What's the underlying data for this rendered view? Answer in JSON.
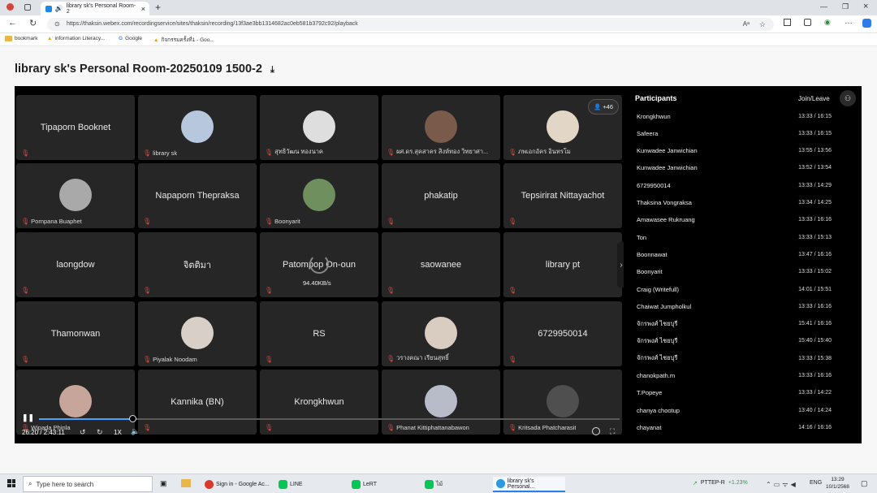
{
  "browser": {
    "tab_title": "library sk's Personal Room-2",
    "url": "https://thaksin.webex.com/recordingservice/sites/thaksin/recording/13f3ae3bb1314682ac0eb581b3792c92/playback",
    "bookmarks": [
      "bookmark",
      "information Literacy...",
      "Google",
      "กิจกรรมครั้งที่1 - Goo..."
    ]
  },
  "recording": {
    "title": "library sk's Personal Room-20250109 1500-2"
  },
  "video": {
    "more_badge": "+46",
    "buffer_speed": "94.40KB/s",
    "tiles": [
      {
        "name": "Tipaporn Booknet",
        "label": "",
        "has_avatar": false
      },
      {
        "name": "",
        "label": "library sk",
        "has_avatar": true,
        "avatar_color": "#b6c7de"
      },
      {
        "name": "",
        "label": "สุทธิวัฒน ทองนาค",
        "has_avatar": true,
        "avatar_color": "#dedede"
      },
      {
        "name": "",
        "label": "ผศ.ดร.สุคสาคร สิงห์ทอง วิทยาศา...",
        "has_avatar": true,
        "avatar_color": "#7a5a4a"
      },
      {
        "name": "",
        "label": "ภพเอกอัคร อินทรโม",
        "has_avatar": true,
        "avatar_color": "#e2d7c6"
      },
      {
        "name": "",
        "label": "Pornpana Buaphet",
        "has_avatar": true,
        "avatar_color": "#a9a9a9"
      },
      {
        "name": "Napaporn Thepraksa",
        "label": "",
        "has_avatar": false
      },
      {
        "name": "",
        "label": "Boonyarit",
        "has_avatar": true,
        "avatar_color": "#6f8f5f"
      },
      {
        "name": "phakatip",
        "label": "",
        "has_avatar": false
      },
      {
        "name": "Tepsirirat Nittayachot",
        "label": "",
        "has_avatar": false
      },
      {
        "name": "laongdow",
        "label": "",
        "has_avatar": false
      },
      {
        "name": "จิตติมา",
        "label": "",
        "has_avatar": false
      },
      {
        "name": "Patompop On-oun",
        "label": "",
        "has_avatar": false
      },
      {
        "name": "saowanee",
        "label": "",
        "has_avatar": false
      },
      {
        "name": "library pt",
        "label": "",
        "has_avatar": false
      },
      {
        "name": "Thamonwan",
        "label": "",
        "has_avatar": false
      },
      {
        "name": "",
        "label": "Piyalak Noodam",
        "has_avatar": true,
        "avatar_color": "#d8d0c8"
      },
      {
        "name": "RS",
        "label": "",
        "has_avatar": false
      },
      {
        "name": "",
        "label": "วรางคณา เรียนสุทธิ์",
        "has_avatar": true,
        "avatar_color": "#d9cdc2"
      },
      {
        "name": "6729950014",
        "label": "",
        "has_avatar": false
      },
      {
        "name": "",
        "label": "Wipada Phinla",
        "has_avatar": true,
        "avatar_color": "#c7a59a"
      },
      {
        "name": "Kannika (BN)",
        "label": "",
        "has_avatar": false
      },
      {
        "name": "Krongkhwun",
        "label": "",
        "has_avatar": false
      },
      {
        "name": "",
        "label": "Phanat Kittiphattanabawon",
        "has_avatar": true,
        "avatar_color": "#b7bcc8"
      },
      {
        "name": "",
        "label": "Kritsada Phatcharasit",
        "has_avatar": true,
        "avatar_color": "#4f4f4f"
      }
    ]
  },
  "player": {
    "time": "26:20 / 2:43:11",
    "speed": "1X",
    "progress": 0.161
  },
  "participants_panel": {
    "title": "Participants",
    "col_header": "Join/Leave",
    "rows": [
      {
        "name": "Krongkhwun",
        "time": "13:33 / 16:15"
      },
      {
        "name": "Safeera",
        "time": "13:33 / 16:15"
      },
      {
        "name": "Kunwadee Janwichian",
        "time": "13:55 / 13:56"
      },
      {
        "name": "Kunwadee Janwichian",
        "time": "13:52 / 13:54"
      },
      {
        "name": "6729950014",
        "time": "13:33 / 14:29"
      },
      {
        "name": "Thaksina Vongraksa",
        "time": "13:34 / 14:25"
      },
      {
        "name": "Amawasee Rukruang",
        "time": "13:33 / 16:16"
      },
      {
        "name": "Ton",
        "time": "13:33 / 15:13"
      },
      {
        "name": "Boonnawat",
        "time": "13:47 / 16:16"
      },
      {
        "name": "Boonyarit",
        "time": "13:33 / 15:02"
      },
      {
        "name": "Craig (Writefull)",
        "time": "14:01 / 15:51"
      },
      {
        "name": "Chaiwat Jumpholkul",
        "time": "13:33 / 16:16"
      },
      {
        "name": "จักรพงศ์ ไชยบุรี",
        "time": "15:41 / 16:16"
      },
      {
        "name": "จักรพงศ์ ไชยบุรี",
        "time": "15:40 / 15:40"
      },
      {
        "name": "จักรพงศ์ ไชยบุรี",
        "time": "13:33 / 15:38"
      },
      {
        "name": "chanokpath.m",
        "time": "13:33 / 16:16"
      },
      {
        "name": "T.Popeye",
        "time": "13:33 / 14:22"
      },
      {
        "name": "chanya chootup",
        "time": "13:40 / 14:24"
      },
      {
        "name": "chayanat",
        "time": "14:16 / 16:16"
      }
    ]
  },
  "taskbar": {
    "search_placeholder": "Type here to search",
    "apps": [
      "Sign in - Google Ac...",
      "LINE",
      "LeRT",
      "ไม้",
      "library sk's Personal..."
    ],
    "stock": "PTTEP-R",
    "stock_change": "+1.23%",
    "lang": "ENG",
    "time": "13:29",
    "date": "10/1/2568"
  }
}
